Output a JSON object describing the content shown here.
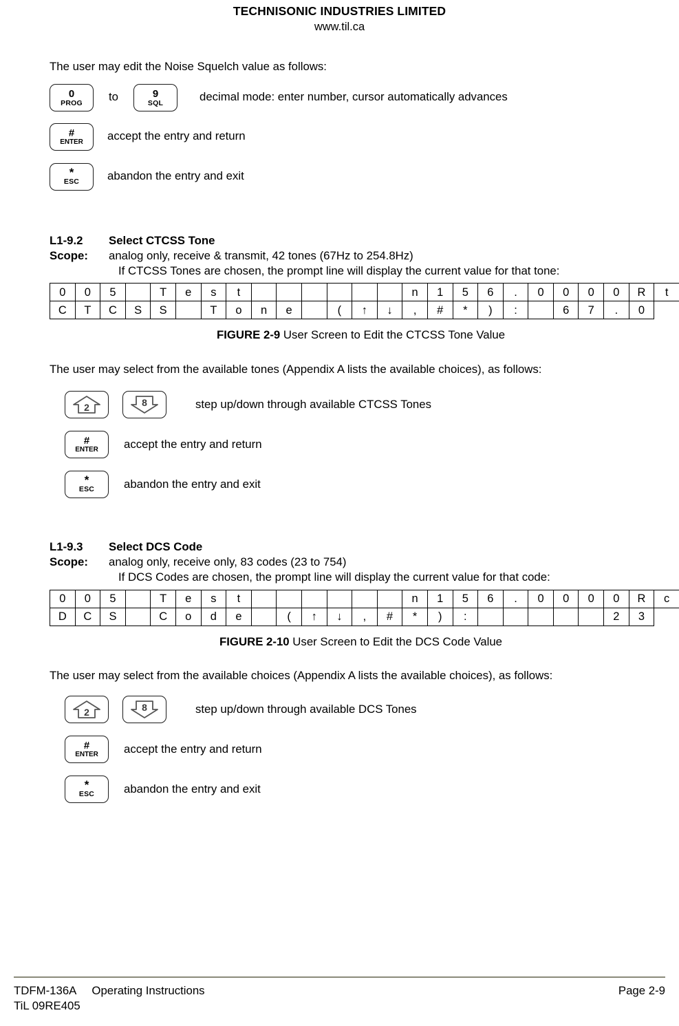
{
  "header": {
    "company": "TECHNISONIC INDUSTRIES LIMITED",
    "website": "www.til.ca"
  },
  "intro": {
    "noise_squelch_line": "The user may edit the Noise Squelch value as follows:"
  },
  "keys": {
    "zero": {
      "top": "0",
      "bottom": "PROG"
    },
    "nine": {
      "top": "9",
      "bottom": "SQL"
    },
    "enter": {
      "top": "#",
      "bottom": "ENTER"
    },
    "esc": {
      "top": "*",
      "bottom": "ESC"
    },
    "up": {
      "digit": "2"
    },
    "down": {
      "digit": "8"
    },
    "to_word": "to"
  },
  "key_labels": {
    "decimal_mode": "decimal mode: enter number, cursor automatically advances",
    "accept": "accept the entry and return",
    "abandon": "abandon the entry and exit",
    "step_ctcss": "step up/down through available CTCSS Tones",
    "step_dcs": "step up/down through available DCS Tones"
  },
  "section_ctcss": {
    "number": "L1-9.2",
    "title": "Select CTCSS Tone",
    "scope_label": "Scope:",
    "scope_text": "analog only, receive & transmit, 42 tones (67Hz to 254.8Hz)",
    "scope_continuation": "If CTCSS Tones are chosen, the prompt line will display the current value for that tone:",
    "figure_number": "FIGURE 2-9",
    "figure_caption": " User Screen to Edit the CTCSS Tone Value",
    "follow_text": "The user may select from the available tones (Appendix A lists the available choices), as follows:"
  },
  "section_dcs": {
    "number": "L1-9.3",
    "title": "Select DCS Code",
    "scope_label": "Scope:",
    "scope_text": "analog only, receive only, 83 codes (23 to 754)",
    "scope_continuation": "If DCS Codes are chosen, the prompt line will display the current value for that code:",
    "figure_number": "FIGURE 2-10",
    "figure_caption": " User Screen to Edit the DCS Code Value",
    "follow_text": "The user may select from the available choices (Appendix A lists the available choices), as follows:"
  },
  "lcd_ctcss": {
    "columns": 24,
    "row1": [
      "0",
      "0",
      "5",
      "",
      "T",
      "e",
      "s",
      "t",
      "",
      "",
      "",
      "",
      "",
      "",
      "n",
      "1",
      "5",
      "6",
      ".",
      "0",
      "0",
      "0",
      "0",
      "R",
      "t"
    ],
    "row2": [
      "C",
      "T",
      "C",
      "S",
      "S",
      "",
      "T",
      "o",
      "n",
      "e",
      "",
      "(",
      "↑",
      "↓",
      ",",
      "#",
      "*",
      ")",
      ":",
      "",
      "6",
      "7",
      ".",
      "0"
    ]
  },
  "lcd_dcs": {
    "columns": 24,
    "row1": [
      "0",
      "0",
      "5",
      "",
      "T",
      "e",
      "s",
      "t",
      "",
      "",
      "",
      "",
      "",
      "",
      "n",
      "1",
      "5",
      "6",
      ".",
      "0",
      "0",
      "0",
      "0",
      "R",
      "c"
    ],
    "row2": [
      "D",
      "C",
      "S",
      "",
      "C",
      "o",
      "d",
      "e",
      "",
      "(",
      "↑",
      "↓",
      ",",
      "#",
      "*",
      ")",
      ":",
      "",
      "",
      "",
      "",
      "",
      "2",
      "3"
    ]
  },
  "footer": {
    "model": "TDFM-136A",
    "doc_type": "Operating Instructions",
    "revision": "TiL 09RE405",
    "page": "Page 2-9"
  }
}
